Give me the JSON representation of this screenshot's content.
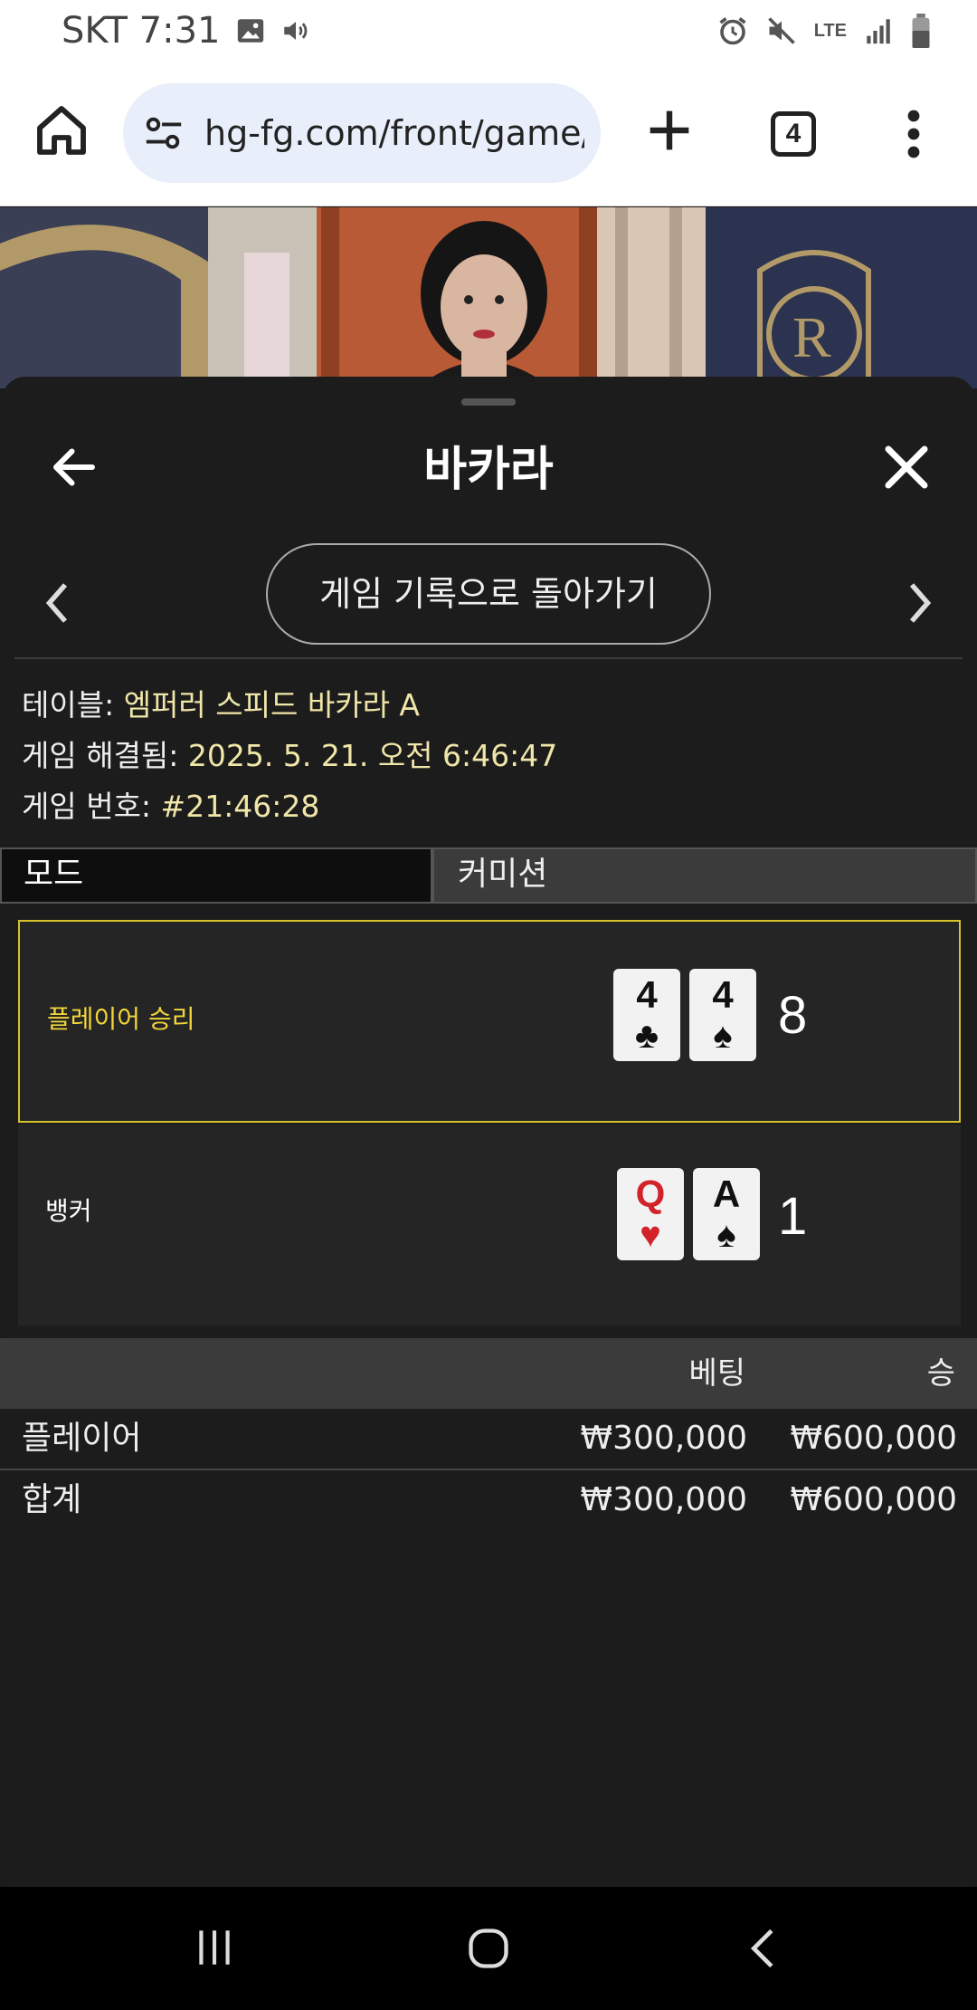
{
  "status_bar": {
    "carrier_time": "SKT 7:31",
    "network": "LTE"
  },
  "browser": {
    "url": "hg-fg.com/front/game/",
    "tab_count": "4"
  },
  "sheet": {
    "title": "바카라",
    "back_to_history": "게임 기록으로 돌아가기"
  },
  "info": {
    "table_label": "테이블: ",
    "table_value": "엠퍼러 스피드 바카라 A",
    "resolved_label": "게임 해결됨: ",
    "resolved_value": "2025. 5. 21. 오전 6:46:47",
    "game_no_label": "게임 번호: ",
    "game_no_value": "#21:46:28"
  },
  "mode_tabs": {
    "mode": "모드",
    "commission": "커미션"
  },
  "hands": {
    "player": {
      "label": "플레이어 승리",
      "label_color": "#f2d63a",
      "cards": [
        {
          "rank": "4",
          "suit": "♣",
          "color": "black"
        },
        {
          "rank": "4",
          "suit": "♠",
          "color": "black"
        }
      ],
      "total": "8"
    },
    "banker": {
      "label": "뱅커",
      "label_color": "#ffffff",
      "cards": [
        {
          "rank": "Q",
          "suit": "♥",
          "color": "red"
        },
        {
          "rank": "A",
          "suit": "♠",
          "color": "black"
        }
      ],
      "total": "1"
    }
  },
  "bets": {
    "headers": {
      "bet": "베팅",
      "win": "승"
    },
    "rows": [
      {
        "name": "플레이어",
        "bet": "₩300,000",
        "win": "₩600,000"
      },
      {
        "name": "합계",
        "bet": "₩300,000",
        "win": "₩600,000"
      }
    ]
  },
  "colors": {
    "accent_yellow": "#d8c22c",
    "value_text": "#f0e6a8",
    "background": "#1c1c1c"
  }
}
